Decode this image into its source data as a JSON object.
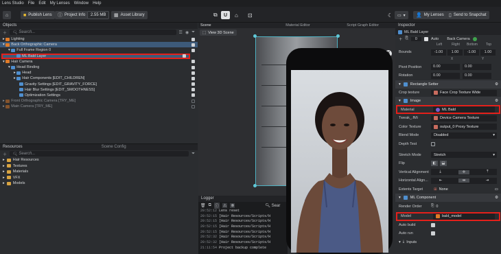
{
  "menu": [
    "Lens Studio",
    "File",
    "Edit",
    "My Lenses",
    "Window",
    "Help"
  ],
  "toolbar": {
    "publish": "Publish Lens",
    "project_info": "Project Info",
    "size": "2.55 MB",
    "asset_library": "Asset Library",
    "my_lenses": "My Lenses",
    "send": "Send to Snapchat"
  },
  "objects": {
    "title": "Objects",
    "search_placeholder": "Search...",
    "rows": [
      {
        "label": "Lighting"
      },
      {
        "label": "Back Orthographic Camera"
      },
      {
        "label": "Full Frame Region 0"
      },
      {
        "label": "ML Bald Layer"
      },
      {
        "label": "Hair Camera"
      },
      {
        "label": "Head Binding"
      },
      {
        "label": "Head"
      },
      {
        "label": "Hair Components [EDIT_CHILDREN]"
      },
      {
        "label": "Gravity Settings [EDIT_GRAVITY_FORCE]"
      },
      {
        "label": "Hair Blur Settings [EDIT_SMOOTHNESS]"
      },
      {
        "label": "Optimization Settings"
      },
      {
        "label": "Front Orthographic Camera [TRY_ME]"
      },
      {
        "label": "Main Camera [TRY_ME]"
      }
    ]
  },
  "resources": {
    "title": "Resources",
    "scene_config": "Scene Config",
    "search_placeholder": "Search...",
    "items": [
      "Hair Resources",
      "Textures",
      "Materials",
      "VFX",
      "Models"
    ]
  },
  "scene": {
    "tabs": [
      "Scene",
      "Material Editor",
      "Script Graph Editor"
    ],
    "view_button": "View 3D Scene"
  },
  "logger": {
    "title": "Logger",
    "search": "Sear",
    "lines": [
      {
        "t": "20:52:12",
        "m": "Lens reset"
      },
      {
        "t": "20:52:15",
        "m": "[Hair Resources/Scripts/H"
      },
      {
        "t": "20:52:15",
        "m": "[Hair Resources/Scripts/H"
      },
      {
        "t": "20:52:15",
        "m": "[Hair Resources/Scripts/H"
      },
      {
        "t": "20:52:15",
        "m": "[Hair Resources/Scripts/H"
      },
      {
        "t": "20:52:32",
        "m": "[Hair Resources/Scripts/H"
      },
      {
        "t": "20:52:32",
        "m": "[Hair Resources/Scripts/H"
      },
      {
        "t": "21:11:54",
        "m": "Project backup complete"
      }
    ]
  },
  "inspector": {
    "title": "Inspector",
    "object_name": "ML Bald Layer",
    "layer_num": "0",
    "auto": "Auto",
    "back_camera": "Back Camera",
    "bounds_label": "Bounds",
    "bounds_headers": [
      "Left",
      "Right",
      "Bottom",
      "Top"
    ],
    "bounds": [
      "-1.00",
      "1.00",
      "-1.00",
      "1.00"
    ],
    "xy_headers": [
      "X",
      "Y"
    ],
    "pivot_label": "Pivot Position",
    "pivot": [
      "0.00",
      "0.00"
    ],
    "rotation_label": "Rotation",
    "rotation": [
      "0.00",
      "0.00"
    ],
    "rect_setter": "Rectangle Setter",
    "crop_label": "Crop texture",
    "crop_value": "Face Crop Texture Wide",
    "image_section": "Image",
    "material_label": "Material",
    "material_value": "ML Bald",
    "tweak_label": "Tweak_.fMi",
    "tweak_value": "Device Camera Texture",
    "color_tex_label": "Color Texture",
    "color_tex_value": "output_0 Proxy Texture",
    "blend_label": "Blend Mode",
    "blend_value": "Disabled",
    "depth_label": "Depth Test",
    "stretch_label": "Stretch Mode",
    "stretch_value": "Stretch",
    "flip_label": "Flip",
    "valign_label": "Vertical Alignment",
    "halign_label": "Horizontal Align...",
    "extents_label": "Extents Target",
    "extents_value": "None",
    "ml_component": "ML Component",
    "render_order_label": "Render Order",
    "render_order_value": "0",
    "model_label": "Model",
    "model_value": "bald_model",
    "auto_build_label": "Auto build",
    "auto_run_label": "Auto run",
    "inputs_label": "Inputs"
  },
  "colors": {
    "accent": "#4f8fcf",
    "highlight": "#e5201b",
    "selection": "#3d5a7a",
    "folder": "#d9a441"
  }
}
